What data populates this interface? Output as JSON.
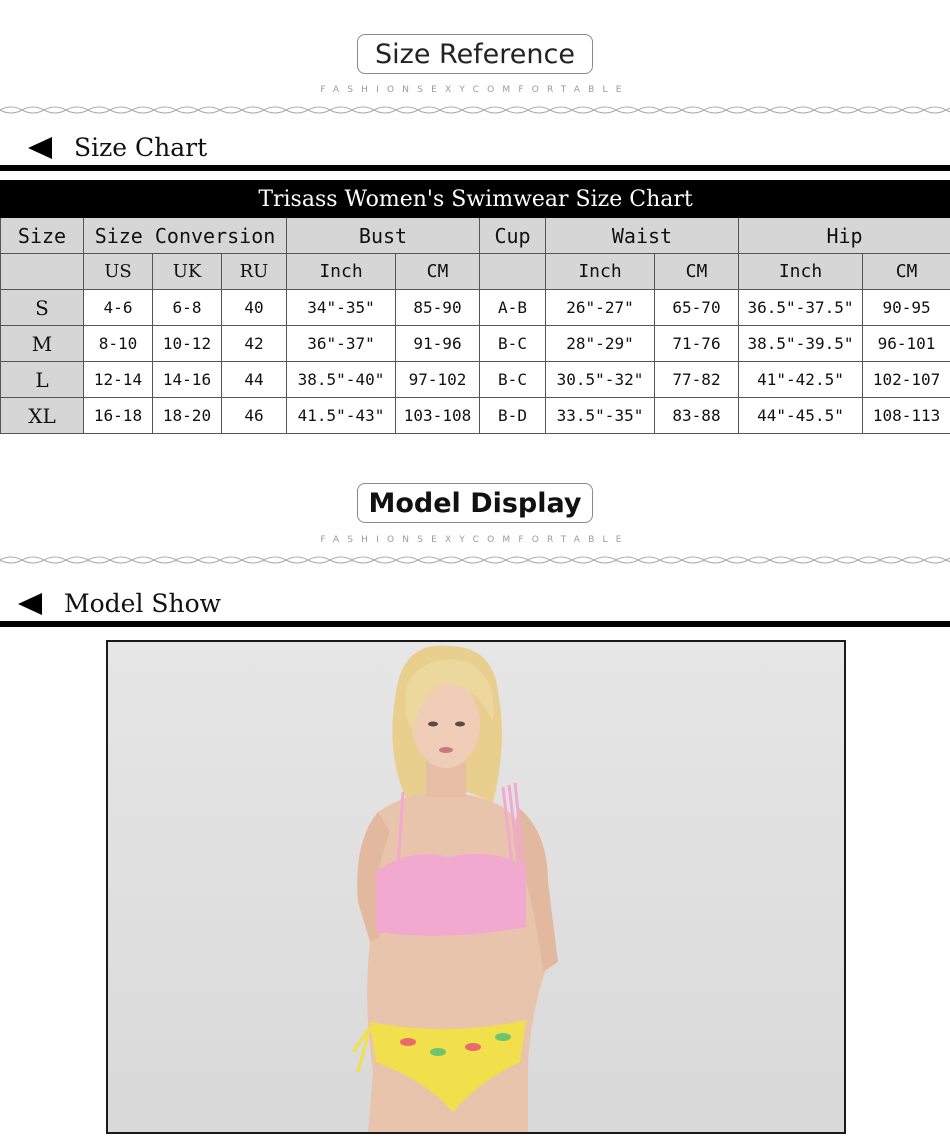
{
  "size_reference": {
    "label": "Size Reference",
    "subtitle": "FASHIONSEXYCOMFORTABLE"
  },
  "size_chart_section": {
    "title": "Size Chart"
  },
  "table": {
    "caption": "Trisass Women's Swimwear Size Chart",
    "group_headers": {
      "size": "Size",
      "conversion": "Size Conversion",
      "bust": "Bust",
      "cup": "Cup",
      "waist": "Waist",
      "hip": "Hip"
    },
    "sub_headers": {
      "us": "US",
      "uk": "UK",
      "ru": "RU",
      "bust_inch": "Inch",
      "bust_cm": "CM",
      "waist_inch": "Inch",
      "waist_cm": "CM",
      "hip_inch": "Inch",
      "hip_cm": "CM"
    },
    "rows": [
      {
        "size": "S",
        "us": "4-6",
        "uk": "6-8",
        "ru": "40",
        "bust_inch": "34\"-35\"",
        "bust_cm": "85-90",
        "cup": "A-B",
        "waist_inch": "26\"-27\"",
        "waist_cm": "65-70",
        "hip_inch": "36.5\"-37.5\"",
        "hip_cm": "90-95"
      },
      {
        "size": "M",
        "us": "8-10",
        "uk": "10-12",
        "ru": "42",
        "bust_inch": "36\"-37\"",
        "bust_cm": "91-96",
        "cup": "B-C",
        "waist_inch": "28\"-29\"",
        "waist_cm": "71-76",
        "hip_inch": "38.5\"-39.5\"",
        "hip_cm": "96-101"
      },
      {
        "size": "L",
        "us": "12-14",
        "uk": "14-16",
        "ru": "44",
        "bust_inch": "38.5\"-40\"",
        "bust_cm": "97-102",
        "cup": "B-C",
        "waist_inch": "30.5\"-32\"",
        "waist_cm": "77-82",
        "hip_inch": "41\"-42.5\"",
        "hip_cm": "102-107"
      },
      {
        "size": "XL",
        "us": "16-18",
        "uk": "18-20",
        "ru": "46",
        "bust_inch": "41.5\"-43\"",
        "bust_cm": "103-108",
        "cup": "B-D",
        "waist_inch": "33.5\"-35\"",
        "waist_cm": "83-88",
        "hip_inch": "44\"-45.5\"",
        "hip_cm": "108-113"
      }
    ]
  },
  "model_display": {
    "label": "Model Display",
    "subtitle": "FASHIONSEXYCOMFORTABLE"
  },
  "model_show_section": {
    "title": "Model Show"
  },
  "colors": {
    "header_gray": "#d6d6d6",
    "caption_bg": "#000000",
    "photo_bg": "#e2e2e2",
    "top_pink": "#f2a9cf",
    "bottom_yellow": "#f2df4c",
    "hair_blonde": "#e8cf8e"
  },
  "icons": {
    "section_arrow": "left-triangle-icon",
    "divider": "wave-divider"
  }
}
